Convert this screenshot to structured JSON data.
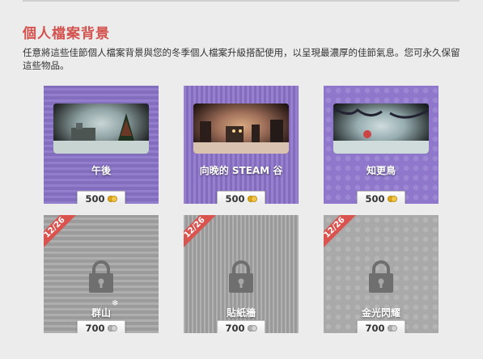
{
  "section": {
    "title": "個人檔案背景",
    "description": "任意將這些佳節個人檔案背景與您的冬季個人檔案升級搭配使用，以呈現最濃厚的佳節氣息。您可永久保留這些物品。"
  },
  "items": [
    {
      "name": "午後",
      "price": "500",
      "locked": false
    },
    {
      "name": "向晚的 STEAM 谷",
      "price": "500",
      "locked": false
    },
    {
      "name": "知更鳥",
      "price": "500",
      "locked": false
    },
    {
      "name": "群山",
      "price": "700",
      "locked": true,
      "ribbon": "12/26"
    },
    {
      "name": "貼紙牆",
      "price": "700",
      "locked": true,
      "ribbon": "12/26"
    },
    {
      "name": "金光閃耀",
      "price": "700",
      "locked": true,
      "ribbon": "12/26"
    }
  ],
  "colors": {
    "title": "#d4524e",
    "unlocked_card": "#8a74c8",
    "locked_card": "#a7a7a7",
    "ribbon": "#d9534f",
    "coin_gold": "#e1a81a"
  },
  "icons": {
    "lock": "padlock-icon",
    "coin": "coin-icon",
    "snowflake": "snowflake-icon"
  }
}
